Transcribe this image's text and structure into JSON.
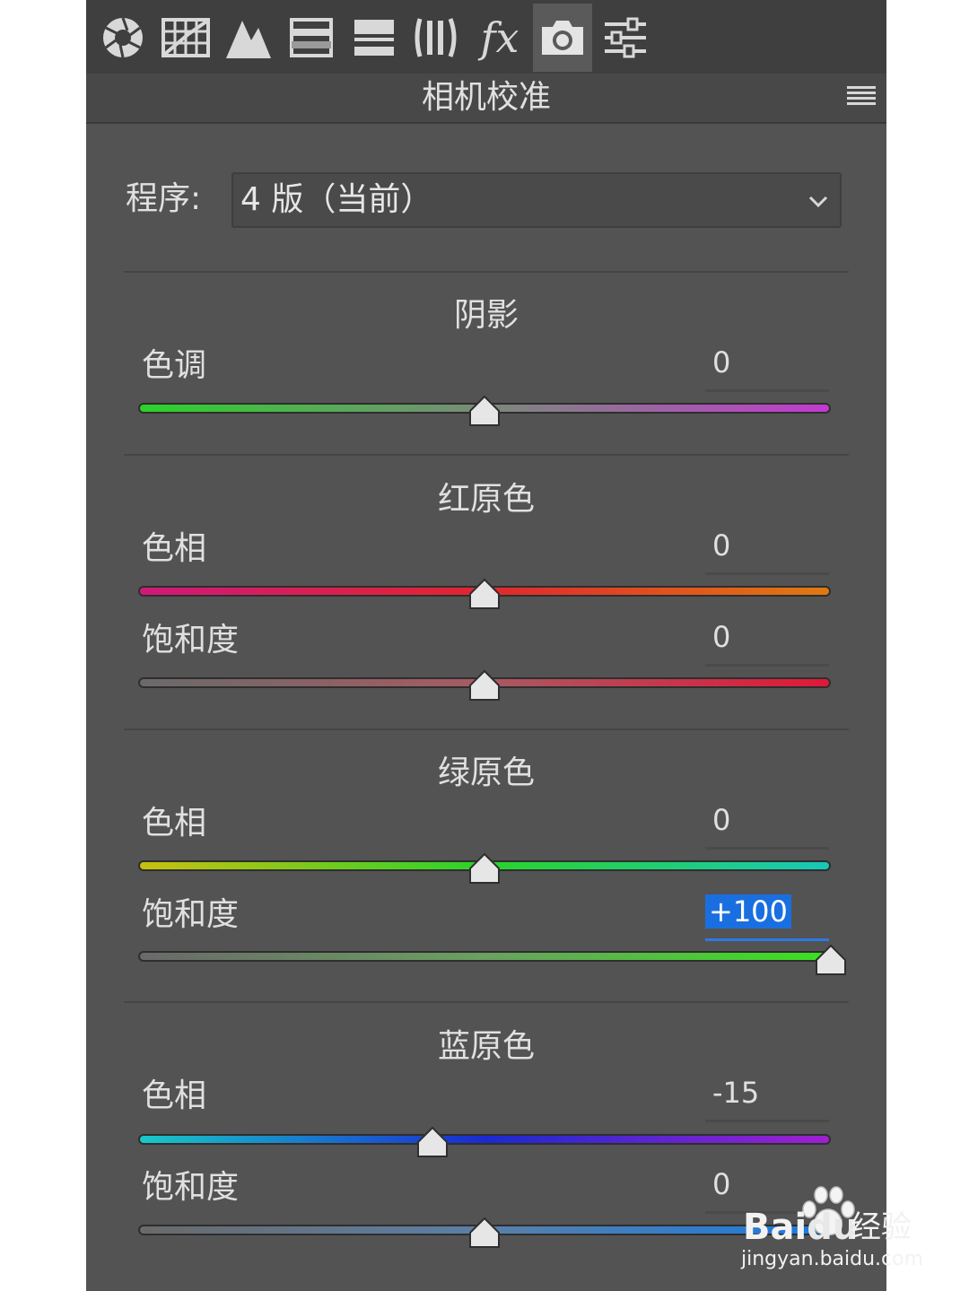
{
  "toolbar": {
    "tools": [
      {
        "icon": "aperture-icon"
      },
      {
        "icon": "grid-icon"
      },
      {
        "icon": "mountains-icon"
      },
      {
        "icon": "split-bars-icon"
      },
      {
        "icon": "stacked-bars-icon"
      },
      {
        "icon": "lens-bars-icon"
      },
      {
        "icon": "fx-icon",
        "text": "fx"
      },
      {
        "icon": "camera-icon",
        "active": true
      },
      {
        "icon": "sliders-icon"
      }
    ]
  },
  "panel": {
    "title": "相机校准",
    "menu_icon": "hamburger-icon"
  },
  "program": {
    "label": "程序:",
    "value": "4 版（当前）",
    "dropdown_icon": "chevron-down-icon"
  },
  "sections": [
    {
      "title": "阴影",
      "rows": [
        {
          "label": "色调",
          "value": "0",
          "fraction": 0.5,
          "colors": [
            "#2ad32a",
            "#7a8a7a",
            "#c23ad0"
          ]
        }
      ]
    },
    {
      "title": "红原色",
      "rows": [
        {
          "label": "色相",
          "value": "0",
          "fraction": 0.5,
          "colors": [
            "#d0197a",
            "#e0262e",
            "#e07a10"
          ]
        },
        {
          "label": "饱和度",
          "value": "0",
          "fraction": 0.5,
          "colors": [
            "#6a6a6a",
            "#a85a62",
            "#e01838"
          ]
        }
      ]
    },
    {
      "title": "绿原色",
      "rows": [
        {
          "label": "色相",
          "value": "0",
          "fraction": 0.5,
          "colors": [
            "#c8c010",
            "#2ad32a",
            "#18c8b8"
          ]
        },
        {
          "label": "饱和度",
          "value": "+100",
          "fraction": 1.0,
          "highlight": true,
          "colors": [
            "#6a6a6a",
            "#6aa060",
            "#3ae020"
          ]
        }
      ]
    },
    {
      "title": "蓝原色",
      "rows": [
        {
          "label": "色相",
          "value": "-15",
          "fraction": 0.425,
          "colors": [
            "#18c8c8",
            "#1a2ad0",
            "#a020d0"
          ]
        },
        {
          "label": "饱和度",
          "value": "0",
          "fraction": 0.5,
          "colors": [
            "#6a6a6a",
            "#5a80a8",
            "#1a7ae0"
          ]
        }
      ]
    }
  ],
  "watermark": {
    "brand": "Bai",
    "brand_end": "du",
    "cn": "经验",
    "url": "jingyan.baidu.com",
    "icon": "baidu-paw-icon"
  }
}
